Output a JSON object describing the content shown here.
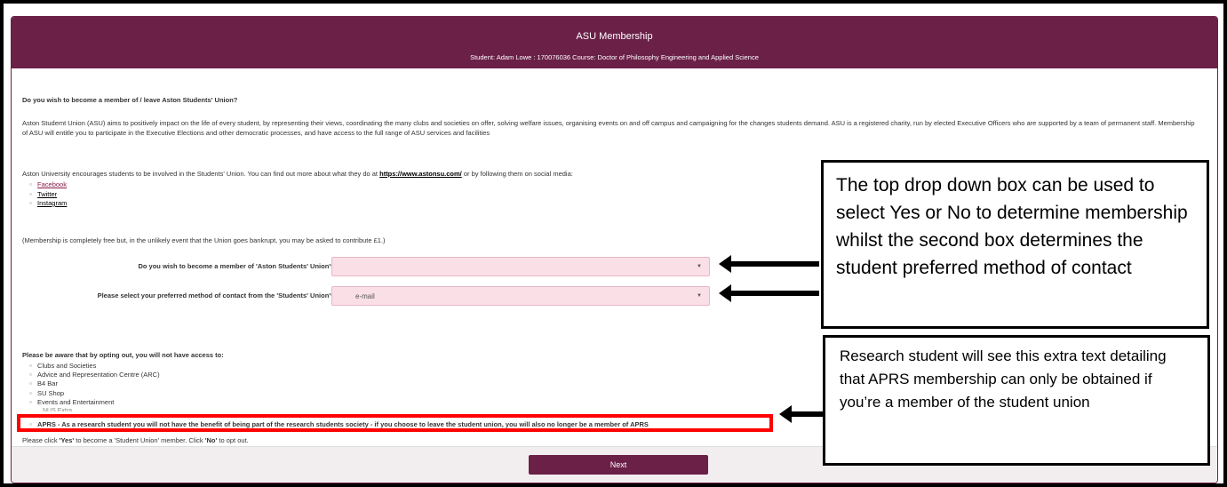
{
  "header": {
    "title": "ASU Membership",
    "student_line": "Student: Adam Lowe : 170076036 Course: Doctor of Philosophy Engineering and Applied Science"
  },
  "content": {
    "question_title": "Do you wish to become a member of / leave Aston Students' Union?",
    "intro": "Aston Studemt Union (ASU) aims to positively impact on the life of every student, by representing their views, coordinating the many clubs and societies on offer, solving welfare issues, organising events on and off campus and campaigning for the changes students demand. ASU is a registered charity, run by elected Executive Officers who are supported by a team of permanent staff. Membership of ASU will entitle you to participate in the Executive Elections and other democratic processes, and have access to the full range of ASU services and facilities",
    "encourage_prefix": "Aston University encourages students to be involved in the Students' Union. You can find out more about what they do at ",
    "encourage_link": "https://www.astonsu.com/",
    "encourage_suffix": " or by following them on social media:",
    "social_links": [
      "Facebook",
      "Twitter",
      "Instagram"
    ],
    "free_note": "(Membership is completely free but, in the unlikely event that the Union goes bankrupt, you may be asked to contribute £1.)",
    "membership_label": "Do you wish to become a member of 'Aston Students' Union'*",
    "membership_value": "",
    "contact_label": "Please select your preferred method of contact from the 'Students' Union'*",
    "contact_value": "e-mail",
    "optout_title": "Please be aware that by opting out, you will not have access to:",
    "optout_items": [
      "Clubs and Societies",
      "Advice and Representation Centre (ARC)",
      "B4 Bar",
      "SU Shop",
      "Events and Entertainment"
    ],
    "nus_fragment": "NUS Extra",
    "aprs_text": "APRS - As a research student you will not have the benefit of being part of the research students society - if you choose to leave the student union, you will also no longer be a member of APRS",
    "click_prefix": "Please click ",
    "click_yes": "'Yes'",
    "click_mid": " to become a 'Student Union' member. Click ",
    "click_no": "'No'",
    "click_suffix": " to opt out."
  },
  "footer": {
    "next_label": "Next"
  },
  "callouts": {
    "dropdowns": "The top drop down box can be used to select Yes or No to determine membership whilst the second box determines the student preferred method of contact",
    "research": "Research student will see this extra text detailing that APRS membership can only be obtained if you’re a member of the student union"
  },
  "colors": {
    "brand": "#6b2048",
    "select_bg": "#fbdfe7",
    "highlight": "#ff0000"
  },
  "icons": {
    "select_caret": "chevron-down-icon",
    "arrow": "left-arrow-icon"
  }
}
